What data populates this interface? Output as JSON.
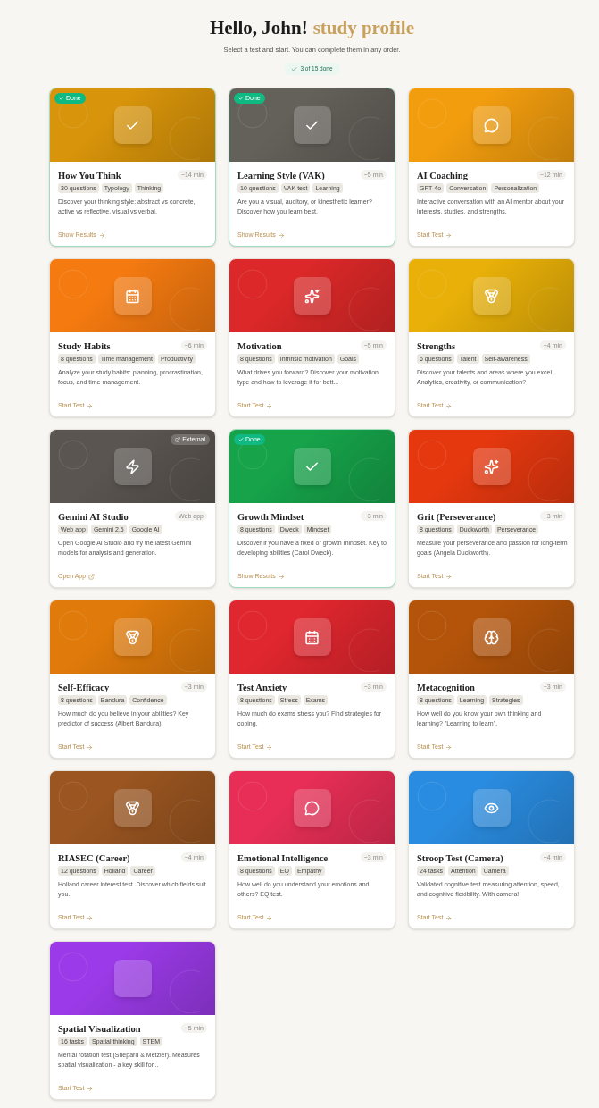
{
  "header": {
    "greeting": "Hello, John!",
    "highlight": "study profile",
    "subtitle": "Select a test and start. You can complete them in any order.",
    "progress": "3 of 15 done"
  },
  "cards": [
    {
      "title": "How You Think",
      "duration": "~14 min",
      "tags": [
        "30 questions",
        "Typology",
        "Thinking"
      ],
      "description": "Discover your thinking style: abstract vs concrete, active vs reflective, visual vs verbal.",
      "action": {
        "label": "Show Results",
        "kind": "arrow"
      },
      "done": true,
      "done_label": "Done",
      "kind": "check",
      "color": "#d8940a"
    },
    {
      "title": "Learning Style (VAK)",
      "duration": "~5 min",
      "tags": [
        "10 questions",
        "VAK test",
        "Learning"
      ],
      "description": "Are you a visual, auditory, or kinesthetic learner? Discover how you learn best.",
      "action": {
        "label": "Show Results",
        "kind": "arrow"
      },
      "done": true,
      "done_label": "Done",
      "kind": "check",
      "color": "#64605a"
    },
    {
      "title": "AI Coaching",
      "duration": "~12 min",
      "tags": [
        "GPT-4o",
        "Conversation",
        "Personalization"
      ],
      "description": "Interactive conversation with an AI mentor about your interests, studies, and strengths.",
      "action": {
        "label": "Start Test",
        "kind": "arrow"
      },
      "done": false,
      "kind": "chat",
      "color": "#f29d0e"
    },
    {
      "title": "Study Habits",
      "duration": "~6 min",
      "tags": [
        "8 questions",
        "Time management",
        "Productivity"
      ],
      "description": "Analyze your study habits: planning, procrastination, focus, and time management.",
      "action": {
        "label": "Start Test",
        "kind": "arrow"
      },
      "done": false,
      "kind": "calendar",
      "color": "#f57a10"
    },
    {
      "title": "Motivation",
      "duration": "~5 min",
      "tags": [
        "8 questions",
        "Intrinsic motivation",
        "Goals"
      ],
      "description": "What drives you forward? Discover your motivation type and how to leverage it for bett...",
      "action": {
        "label": "Start Test",
        "kind": "arrow"
      },
      "done": false,
      "kind": "sparkles",
      "color": "#dc2828"
    },
    {
      "title": "Strengths",
      "duration": "~4 min",
      "tags": [
        "6 questions",
        "Talent",
        "Self-awareness"
      ],
      "description": "Discover your talents and areas where you excel. Analytics, creativity, or communication?",
      "action": {
        "label": "Start Test",
        "kind": "arrow"
      },
      "done": false,
      "kind": "medal",
      "color": "#e8b008"
    },
    {
      "title": "Gemini AI Studio",
      "duration": "Web app",
      "tags": [
        "Web app",
        "Gemini 2.5",
        "Google AI"
      ],
      "description": "Open Google AI Studio and try the latest Gemini models for analysis and generation.",
      "action": {
        "label": "Open App",
        "kind": "external"
      },
      "done": false,
      "external_label": "External",
      "kind": "bolt",
      "color": "#5a5550"
    },
    {
      "title": "Growth Mindset",
      "duration": "~3 min",
      "tags": [
        "8 questions",
        "Dweck",
        "Mindset"
      ],
      "description": "Discover if you have a fixed or growth mindset. Key to developing abilities (Carol Dweck).",
      "action": {
        "label": "Show Results",
        "kind": "arrow"
      },
      "done": true,
      "done_label": "Done",
      "kind": "check",
      "color": "#16a34a"
    },
    {
      "title": "Grit (Perseverance)",
      "duration": "~3 min",
      "tags": [
        "8 questions",
        "Duckworth",
        "Perseverance"
      ],
      "description": "Measure your perseverance and passion for long-term goals (Angela Duckworth).",
      "action": {
        "label": "Start Test",
        "kind": "arrow"
      },
      "done": false,
      "kind": "sparkles",
      "color": "#e6380f"
    },
    {
      "title": "Self-Efficacy",
      "duration": "~3 min",
      "tags": [
        "8 questions",
        "Bandura",
        "Confidence"
      ],
      "description": "How much do you believe in your abilities? Key predictor of success (Albert Bandura).",
      "action": {
        "label": "Start Test",
        "kind": "arrow"
      },
      "done": false,
      "kind": "medal",
      "color": "#e07a0a"
    },
    {
      "title": "Test Anxiety",
      "duration": "~3 min",
      "tags": [
        "8 questions",
        "Stress",
        "Exams"
      ],
      "description": "How much do exams stress you? Find strategies for coping.",
      "action": {
        "label": "Start Test",
        "kind": "arrow"
      },
      "done": false,
      "kind": "calendar",
      "color": "#e0262e"
    },
    {
      "title": "Metacognition",
      "duration": "~3 min",
      "tags": [
        "8 questions",
        "Learning",
        "Strategies"
      ],
      "description": "How well do you know your own thinking and learning? \"Learning to learn\".",
      "action": {
        "label": "Start Test",
        "kind": "arrow"
      },
      "done": false,
      "kind": "brain",
      "color": "#b4540a"
    },
    {
      "title": "RIASEC (Career)",
      "duration": "~4 min",
      "tags": [
        "12 questions",
        "Holland",
        "Career"
      ],
      "description": "Holland career interest test. Discover which fields suit you.",
      "action": {
        "label": "Start Test",
        "kind": "arrow"
      },
      "done": false,
      "kind": "medal",
      "color": "#9a5520"
    },
    {
      "title": "Emotional Intelligence",
      "duration": "~3 min",
      "tags": [
        "8 questions",
        "EQ",
        "Empathy"
      ],
      "description": "How well do you understand your emotions and others? EQ test.",
      "action": {
        "label": "Start Test",
        "kind": "arrow"
      },
      "done": false,
      "kind": "chat",
      "color": "#e82e56"
    },
    {
      "title": "Stroop Test (Camera)",
      "duration": "~4 min",
      "tags": [
        "24 tasks",
        "Attention",
        "Camera"
      ],
      "description": "Validated cognitive test measuring attention, speed, and cognitive flexibility. With camera!",
      "action": {
        "label": "Start Test",
        "kind": "arrow"
      },
      "done": false,
      "kind": "eye",
      "color": "#2a8ce0"
    },
    {
      "title": "Spatial Visualization",
      "duration": "~5 min",
      "tags": [
        "16 tasks",
        "Spatial thinking",
        "STEM"
      ],
      "description": "Mental rotation test (Shepard & Metzler). Measures spatial visualization - a key skill for...",
      "action": {
        "label": "Start Test",
        "kind": "arrow"
      },
      "done": false,
      "kind": "blank",
      "color": "#9b3ae8"
    }
  ]
}
